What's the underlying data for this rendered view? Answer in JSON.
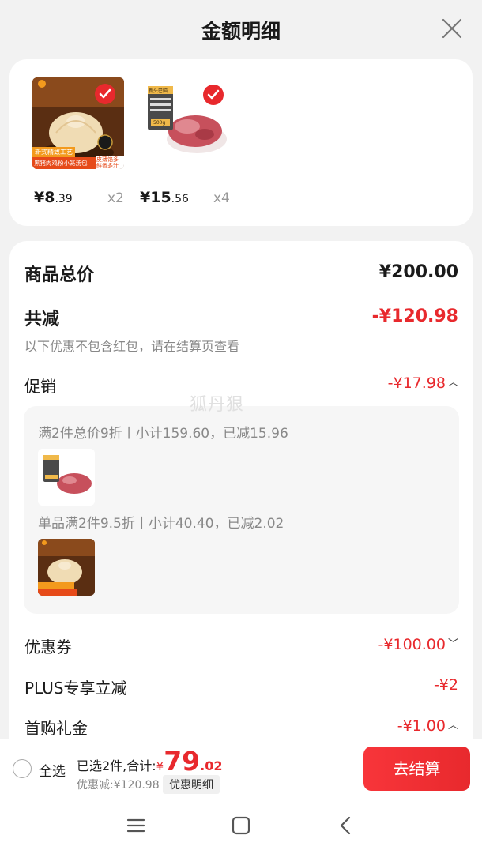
{
  "header": {
    "title": "金额明细"
  },
  "products": [
    {
      "price_int": "¥8",
      "price_dec": ".39",
      "qty": "x2"
    },
    {
      "price_int": "¥15",
      "price_dec": ".56",
      "qty": "x4"
    }
  ],
  "product_image_text": {
    "tangbao_band": "新式精致工艺",
    "tangbao_name": "黑猪肉鸡粉小笼汤包",
    "tangbao_tag": "皮薄馅多 鲜香多汁",
    "beef_tag": "新头巴脑",
    "beef_weight": "500g"
  },
  "summary": {
    "total_label": "商品总价",
    "total_value": "¥200.00",
    "reduce_label": "共减",
    "reduce_value": "-¥120.98",
    "reduce_note": "以下优惠不包含红包，请在结算页查看",
    "promo_label": "促销",
    "promo_value": "-¥17.98",
    "promo_items": [
      {
        "text": "满2件总价9折丨小计159.60，已减15.96"
      },
      {
        "text": "单品满2件9.5折丨小计40.40，已减2.02"
      }
    ],
    "coupon_label": "优惠券",
    "coupon_value": "-¥100.00",
    "plus_label": "PLUS专享立减",
    "plus_value": "-¥2",
    "gift_label": "首购礼金",
    "gift_value": "-¥1.00"
  },
  "watermark": "狐丹狠",
  "bottom_bar": {
    "select_all": "全选",
    "selected_text": "已选2件,合计:",
    "currency": "¥",
    "amount_int": "79",
    "amount_dec": ".02",
    "discount_text": "优惠减:¥120.98",
    "detail_label": "优惠明细",
    "checkout_label": "去结算"
  },
  "colors": {
    "accent_red": "#e8292d"
  }
}
